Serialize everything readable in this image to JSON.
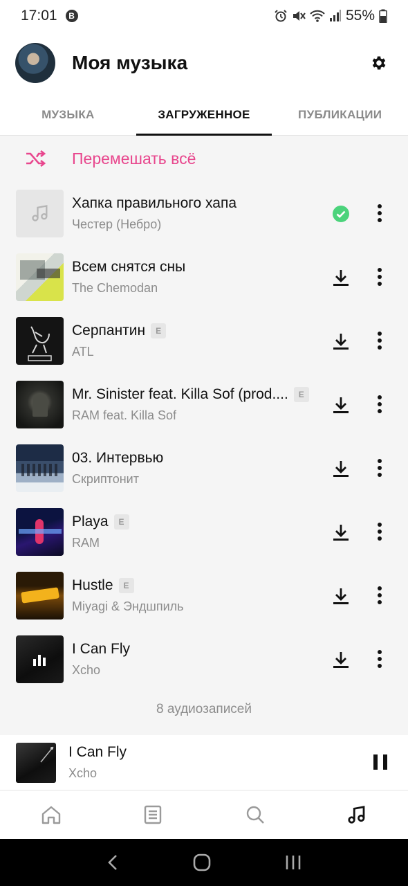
{
  "status_bar": {
    "time": "17:01",
    "notification_badge": "В",
    "battery": "55%"
  },
  "header": {
    "title": "Моя музыка",
    "settings_icon": "gear-icon"
  },
  "tabs": [
    {
      "label": "МУЗЫКА",
      "active": false
    },
    {
      "label": "ЗАГРУЖЕННОЕ",
      "active": true
    },
    {
      "label": "ПУБЛИКАЦИИ",
      "active": false
    }
  ],
  "shuffle": {
    "label": "Перемешать всё",
    "color": "#e8468d"
  },
  "explicit_badge": "E",
  "tracks": [
    {
      "title": "Хапка правильного хапа",
      "artist": "Честер (Небро)",
      "explicit": false,
      "status": "downloaded"
    },
    {
      "title": "Всем снятся сны",
      "artist": "The Chemodan",
      "explicit": false,
      "status": "download"
    },
    {
      "title": "Серпантин",
      "artist": "ATL",
      "explicit": true,
      "status": "download"
    },
    {
      "title": "Mr. Sinister feat. Killa Sof (prod....",
      "artist": "RAM feat. Killa Sof",
      "explicit": true,
      "status": "download"
    },
    {
      "title": "03. Интервью",
      "artist": "Скриптонит",
      "explicit": false,
      "status": "download"
    },
    {
      "title": "Playa",
      "artist": "RAM",
      "explicit": true,
      "status": "download"
    },
    {
      "title": "Hustle",
      "artist": "Miyagi & Эндшпиль",
      "explicit": true,
      "status": "download"
    },
    {
      "title": "I Can Fly",
      "artist": "Xcho",
      "explicit": false,
      "status": "download"
    }
  ],
  "count_label": "8 аудиозаписей",
  "now_playing": {
    "title": "I Can Fly",
    "artist": "Xcho",
    "state": "playing"
  },
  "bottom_nav": [
    "home-icon",
    "feed-icon",
    "search-icon",
    "music-icon"
  ],
  "colors": {
    "accent": "#e8468d",
    "downloaded": "#4bd37b"
  }
}
